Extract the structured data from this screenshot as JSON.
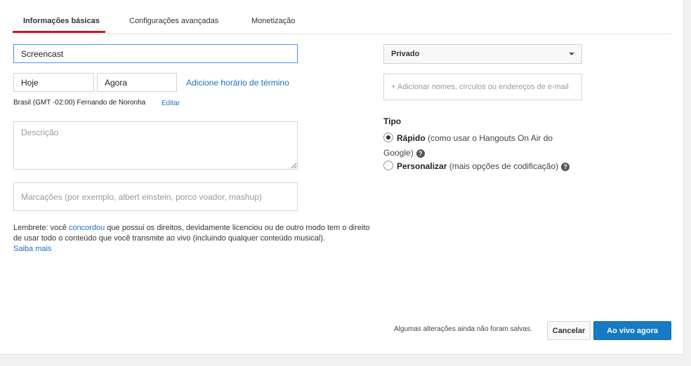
{
  "tabs": [
    {
      "label": "Informações básicas",
      "active": true
    },
    {
      "label": "Configurações avançadas",
      "active": false
    },
    {
      "label": "Monetização",
      "active": false
    }
  ],
  "form": {
    "title_value": "Screencast",
    "date_value": "Hoje",
    "time_value": "Agora",
    "add_end_time_link": "Adicione horário de término",
    "timezone_text": "Brasil (GMT -02:00) Fernando de Noronha",
    "edit_link": "Editar",
    "description_placeholder": "Descrição",
    "tags_placeholder": "Marcações (por exemplo, albert einstein, porco voador, mashup)"
  },
  "notice": {
    "before": "Lembrete: você ",
    "agreed_link": "concordou",
    "after": " que possui os direitos, devidamente licenciou ou de outro modo tem o direito de usar todo o conteúdo que você transmite ao vivo (incluindo qualquer conteúdo musical).",
    "learn_more_link": "Saiba mais"
  },
  "privacy": {
    "selected": "Privado",
    "share_placeholder": "+ Adicionar nomes, círculos ou endereços de e-mail"
  },
  "type": {
    "label": "Tipo",
    "options": [
      {
        "title": "Rápido",
        "description": " (como usar o Hangouts On Air do Google)",
        "checked": true
      },
      {
        "title": "Personalizar",
        "description": " (mais opções de codificação)",
        "checked": false
      }
    ]
  },
  "footer": {
    "unsaved_text": "Algumas alterações ainda não foram salvas.",
    "cancel_label": "Cancelar",
    "go_live_label": "Ao vivo agora"
  },
  "colors": {
    "accent_red": "#cc181e",
    "link_blue": "#1a6fc1",
    "primary_button": "#167ac6"
  }
}
